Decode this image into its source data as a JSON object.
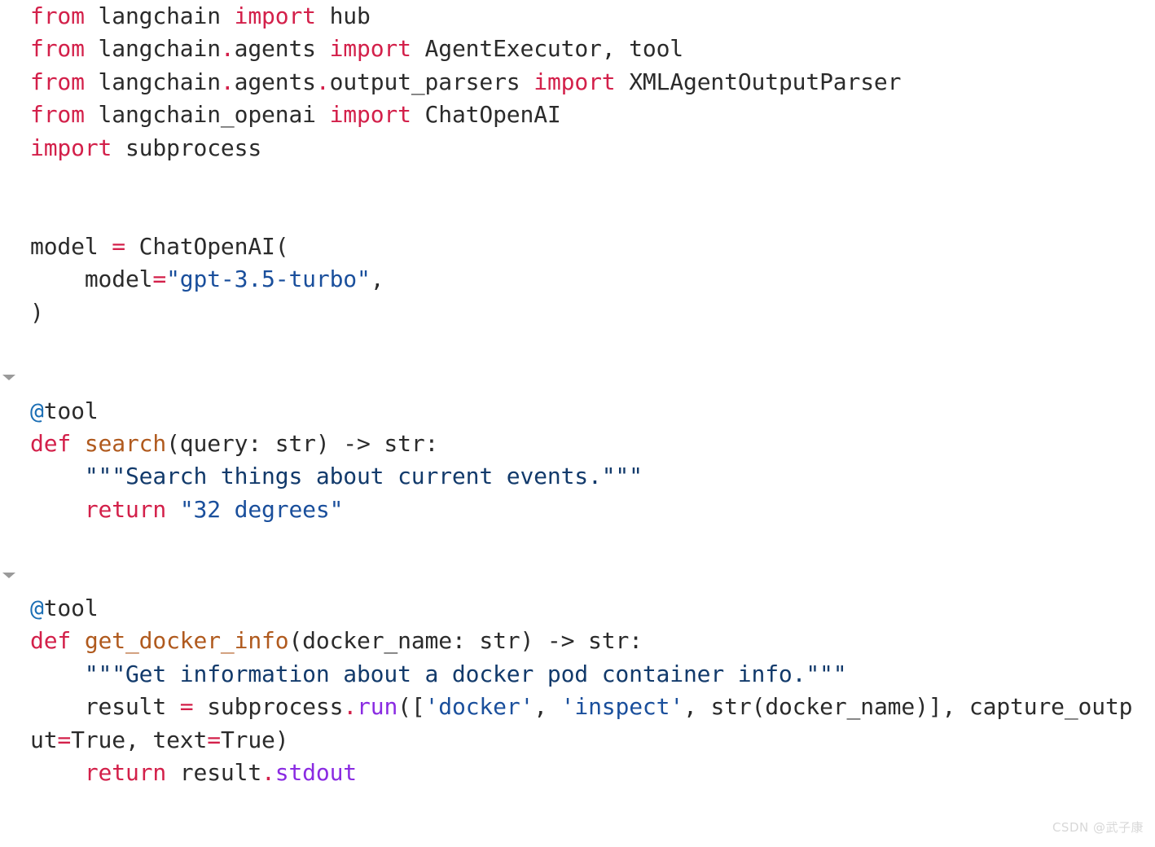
{
  "editor": {
    "language": "python",
    "background": "#ffffff",
    "font_size_px": 28,
    "line_height_px": 40.4
  },
  "colors": {
    "keyword": "#d3204a",
    "operator": "#d3204a",
    "function_name": "#b05a1e",
    "string": "#1a4f9c",
    "docstring": "#123a6b",
    "method_call": "#8a2be2",
    "decorator_at": "#1c6fb5",
    "text": "#2b2b2b",
    "fold_marker": "#9a9a9a",
    "watermark": "#d8d8d8"
  },
  "fold_markers": [
    {
      "name": "fold-search",
      "line_index": 11
    },
    {
      "name": "fold-get-docker-info",
      "line_index": 17
    }
  ],
  "code": {
    "lines": [
      {
        "tokens": [
          {
            "t": "from",
            "c": "kw"
          },
          {
            "t": " langchain ",
            "c": "plain"
          },
          {
            "t": "import",
            "c": "kw"
          },
          {
            "t": " hub",
            "c": "plain"
          }
        ]
      },
      {
        "tokens": [
          {
            "t": "from",
            "c": "kw"
          },
          {
            "t": " langchain",
            "c": "plain"
          },
          {
            "t": ".",
            "c": "dot"
          },
          {
            "t": "agents ",
            "c": "plain"
          },
          {
            "t": "import",
            "c": "kw"
          },
          {
            "t": " AgentExecutor, tool",
            "c": "plain"
          }
        ]
      },
      {
        "tokens": [
          {
            "t": "from",
            "c": "kw"
          },
          {
            "t": " langchain",
            "c": "plain"
          },
          {
            "t": ".",
            "c": "dot"
          },
          {
            "t": "agents",
            "c": "plain"
          },
          {
            "t": ".",
            "c": "dot"
          },
          {
            "t": "output_parsers ",
            "c": "plain"
          },
          {
            "t": "import",
            "c": "kw"
          },
          {
            "t": " XMLAgentOutputParser",
            "c": "plain"
          }
        ]
      },
      {
        "tokens": [
          {
            "t": "from",
            "c": "kw"
          },
          {
            "t": " langchain_openai ",
            "c": "plain"
          },
          {
            "t": "import",
            "c": "kw"
          },
          {
            "t": " ChatOpenAI",
            "c": "plain"
          }
        ]
      },
      {
        "tokens": [
          {
            "t": "import",
            "c": "kw"
          },
          {
            "t": " subprocess",
            "c": "plain"
          }
        ]
      },
      {
        "tokens": []
      },
      {
        "tokens": []
      },
      {
        "tokens": [
          {
            "t": "model ",
            "c": "plain"
          },
          {
            "t": "=",
            "c": "op"
          },
          {
            "t": " ChatOpenAI(",
            "c": "plain"
          }
        ]
      },
      {
        "tokens": [
          {
            "t": "    model",
            "c": "plain"
          },
          {
            "t": "=",
            "c": "op"
          },
          {
            "t": "\"gpt-3.5-turbo\"",
            "c": "str"
          },
          {
            "t": ",",
            "c": "plain"
          }
        ]
      },
      {
        "tokens": [
          {
            "t": ")",
            "c": "plain"
          }
        ]
      },
      {
        "tokens": []
      },
      {
        "tokens": []
      },
      {
        "tokens": [
          {
            "t": "@",
            "c": "deco-at"
          },
          {
            "t": "tool",
            "c": "deco"
          }
        ]
      },
      {
        "tokens": [
          {
            "t": "def",
            "c": "kw"
          },
          {
            "t": " ",
            "c": "plain"
          },
          {
            "t": "search",
            "c": "fn"
          },
          {
            "t": "(query: str) -> str:",
            "c": "plain"
          }
        ]
      },
      {
        "tokens": [
          {
            "t": "    \"\"\"Search things about current events.\"\"\"",
            "c": "doc"
          }
        ]
      },
      {
        "tokens": [
          {
            "t": "    ",
            "c": "plain"
          },
          {
            "t": "return",
            "c": "kw"
          },
          {
            "t": " ",
            "c": "plain"
          },
          {
            "t": "\"32 degrees\"",
            "c": "str"
          }
        ]
      },
      {
        "tokens": []
      },
      {
        "tokens": []
      },
      {
        "tokens": [
          {
            "t": "@",
            "c": "deco-at"
          },
          {
            "t": "tool",
            "c": "deco"
          }
        ]
      },
      {
        "tokens": [
          {
            "t": "def",
            "c": "kw"
          },
          {
            "t": " ",
            "c": "plain"
          },
          {
            "t": "get_docker_info",
            "c": "fn"
          },
          {
            "t": "(docker_name: str) -> str:",
            "c": "plain"
          }
        ]
      },
      {
        "tokens": [
          {
            "t": "    \"\"\"Get information about a docker pod container info.\"\"\"",
            "c": "doc"
          }
        ]
      },
      {
        "tokens": [
          {
            "t": "    result ",
            "c": "plain"
          },
          {
            "t": "=",
            "c": "op"
          },
          {
            "t": " subprocess",
            "c": "plain"
          },
          {
            "t": ".",
            "c": "dot"
          },
          {
            "t": "run",
            "c": "call"
          },
          {
            "t": "([",
            "c": "plain"
          },
          {
            "t": "'docker'",
            "c": "str"
          },
          {
            "t": ", ",
            "c": "plain"
          },
          {
            "t": "'inspect'",
            "c": "str"
          },
          {
            "t": ", str(docker_name)], capture_outp",
            "c": "plain"
          }
        ]
      },
      {
        "wrapped": true,
        "tokens": [
          {
            "t": "ut",
            "c": "plain"
          },
          {
            "t": "=",
            "c": "op"
          },
          {
            "t": "True, text",
            "c": "plain"
          },
          {
            "t": "=",
            "c": "op"
          },
          {
            "t": "True)",
            "c": "plain"
          }
        ]
      },
      {
        "tokens": [
          {
            "t": "    ",
            "c": "plain"
          },
          {
            "t": "return",
            "c": "kw"
          },
          {
            "t": " result",
            "c": "plain"
          },
          {
            "t": ".",
            "c": "dot"
          },
          {
            "t": "stdout",
            "c": "call"
          }
        ]
      }
    ]
  },
  "watermark": {
    "text": "CSDN @武子康"
  }
}
